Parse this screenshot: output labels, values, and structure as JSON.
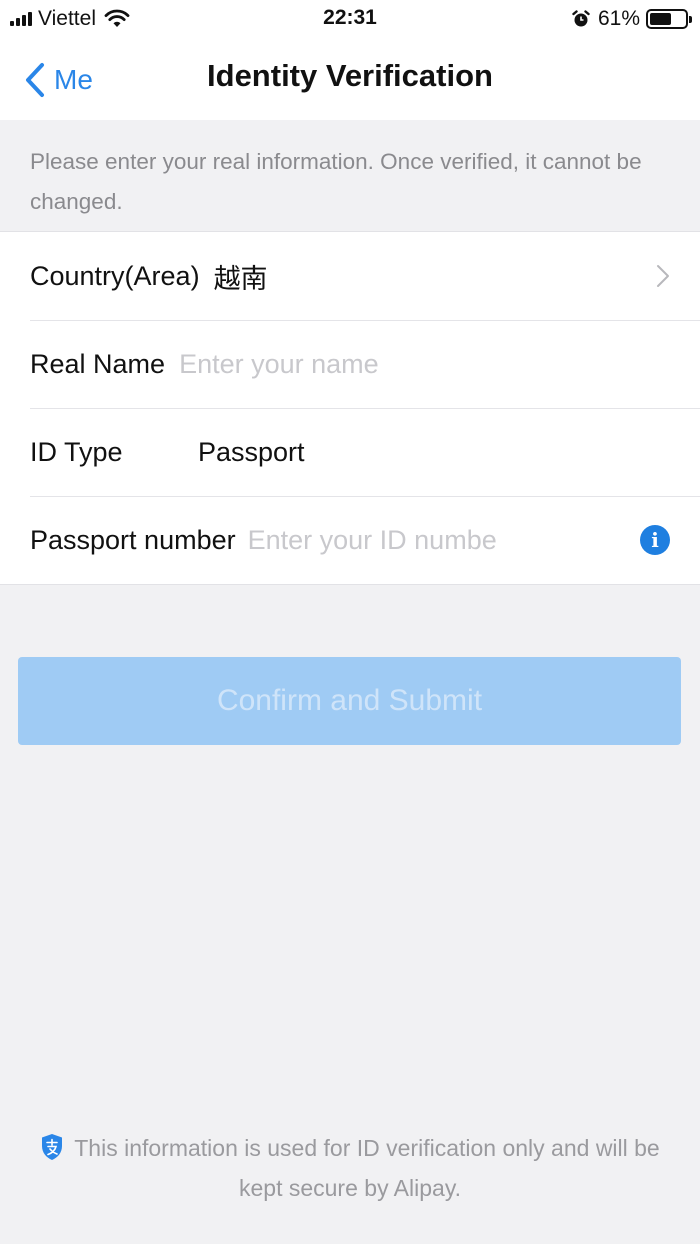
{
  "status_bar": {
    "carrier": "Viettel",
    "time": "22:31",
    "battery_percent_label": "61%",
    "battery_level": 0.61
  },
  "nav": {
    "back_label": "Me",
    "title": "Identity Verification"
  },
  "notice": {
    "text": "Please enter your real information. Once verified, it cannot be changed."
  },
  "form": {
    "country": {
      "label": "Country(Area)",
      "value": "越南"
    },
    "real_name": {
      "label": "Real Name",
      "placeholder": "Enter your name"
    },
    "id_type": {
      "label": "ID Type",
      "value": "Passport"
    },
    "passport_number": {
      "label": "Passport number",
      "placeholder": "Enter your ID numbe"
    }
  },
  "submit": {
    "label": "Confirm and Submit"
  },
  "footer": {
    "text": "This information is used for ID verification only and will be kept secure by Alipay."
  },
  "icons": {
    "back": "chevron-left-icon",
    "disclosure": "chevron-right-icon",
    "info": "info-icon",
    "footer": "alipay-shield-icon"
  },
  "colors": {
    "accent": "#2a86e8",
    "info": "#1f7fe0",
    "submit_disabled_bg": "#9fcbf4",
    "shield": "#2a86e8"
  }
}
